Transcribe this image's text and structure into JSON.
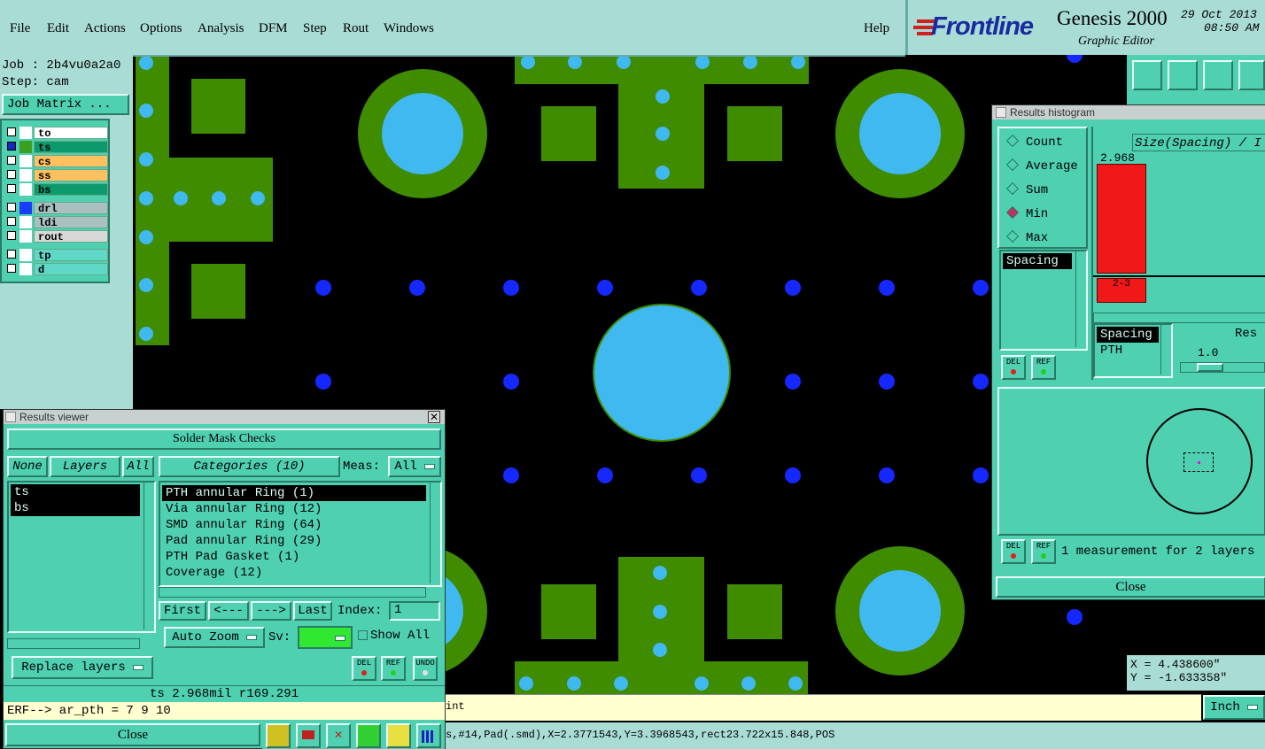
{
  "menu": {
    "items": [
      "File",
      "Edit",
      "Actions",
      "Options",
      "Analysis",
      "DFM",
      "Step",
      "Rout",
      "Windows"
    ],
    "help": "Help"
  },
  "brand": {
    "logo": "Frontline",
    "product": "Genesis 2000",
    "subtitle": "Graphic Editor",
    "date": "29 Oct 2013",
    "time": "08:50 AM"
  },
  "job": {
    "job_label": "Job : 2b4vu0a2a0",
    "step_label": "Step: cam",
    "matrix_button": "Job Matrix ..."
  },
  "layers": [
    {
      "name": "to",
      "color": "#ffffff",
      "swatch": "#ffffff"
    },
    {
      "name": "ts",
      "color": "#0c9a6c",
      "swatch": "#3aa020"
    },
    {
      "name": "cs",
      "color": "#ffc060",
      "swatch": "#ffffff"
    },
    {
      "name": "ss",
      "color": "#ffc060",
      "swatch": "#ffffff"
    },
    {
      "name": "bs",
      "color": "#0c9a6c",
      "swatch": "#ffffff"
    },
    {
      "name": "drl",
      "color": "#a8c0c0",
      "swatch": "#1a3cff"
    },
    {
      "name": "ldi",
      "color": "#a8c0c0",
      "swatch": "#ffffff"
    },
    {
      "name": "rout",
      "color": "#d8d8d8",
      "swatch": "#ffffff"
    },
    {
      "name": "tp",
      "color": "#60d8c8",
      "swatch": "#ffffff"
    },
    {
      "name": "d",
      "color": "#60d8c8",
      "swatch": "#ffffff"
    }
  ],
  "results_viewer": {
    "title": "Results viewer",
    "header": "Solder Mask Checks",
    "none_btn": "None",
    "layers_btn": "Layers",
    "all_btn": "All",
    "categories_btn": "Categories (10)",
    "meas_label": "Meas:",
    "meas_value": "All",
    "layer_list": [
      "ts",
      "bs"
    ],
    "categories": [
      "PTH annular Ring (1)",
      "Via annular Ring (12)",
      "SMD annular Ring (64)",
      "Pad annular Ring (29)",
      "PTH Pad Gasket (1)",
      "Coverage (12)"
    ],
    "first_btn": "First",
    "prev_btn": "<---",
    "next_btn": "--->",
    "last_btn": "Last",
    "index_label": "Index:",
    "index_value": "1",
    "auto_zoom": "Auto Zoom",
    "sv_label": "Sv:",
    "show_all": "Show All",
    "replace_layers": "Replace layers",
    "del": "DEL",
    "ref": "REF",
    "undo": "UNDO",
    "status": "ts 2.968mil  r169.291",
    "erf": "ERF--> ar_pth = 7 9 10",
    "close": "Close"
  },
  "histogram": {
    "title": "Results histogram",
    "modes": [
      "Count",
      "Average",
      "Sum",
      "Min",
      "Max"
    ],
    "selected_mode": "Min",
    "size_label": "Size(Spacing) / I",
    "bar_value": "2.968",
    "bin_label": "2-3",
    "left_list": [
      "Spacing"
    ],
    "right_list": [
      "Spacing",
      "PTH"
    ],
    "res_label": "Res",
    "slider_value": "1.0",
    "del": "DEL",
    "ref": "REF",
    "summary": "1 measurement for 2 layers",
    "close": "Close"
  },
  "coords": {
    "x": "X = 4.438600\"",
    "y": "Y = -1.633358\""
  },
  "bottom": {
    "hint": "int",
    "units": "Inch",
    "status_line": "s,#14,Pad(.smd),X=2.3771543,Y=3.3968543,rect23.722x15.848,POS"
  }
}
